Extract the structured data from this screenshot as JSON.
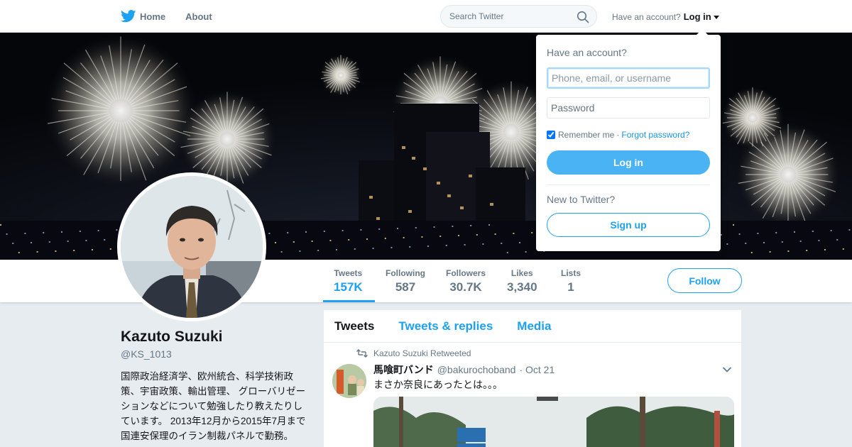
{
  "nav": {
    "home_label": "Home",
    "about_label": "About",
    "search_placeholder": "Search Twitter",
    "have_account_label": "Have an account?",
    "login_label": "Log in"
  },
  "profile": {
    "name": "Kazuto Suzuki",
    "handle": "@KS_1013",
    "bio": "国際政治経済学、欧州統合、科学技術政策、宇宙政策、輸出管理、 グローバリゼーションなどについて勉強したり教えたりしています。 2013年12月から2015年7月まで国連安保理のイラン制裁パネルで勤務。 Sorry folks, all tweets are in",
    "follow_label": "Follow"
  },
  "stats": [
    {
      "label": "Tweets",
      "value": "157K",
      "active": true
    },
    {
      "label": "Following",
      "value": "587",
      "active": false
    },
    {
      "label": "Followers",
      "value": "30.7K",
      "active": false
    },
    {
      "label": "Likes",
      "value": "3,340",
      "active": false
    },
    {
      "label": "Lists",
      "value": "1",
      "active": false
    }
  ],
  "tabs": [
    {
      "label": "Tweets",
      "active": true
    },
    {
      "label": "Tweets & replies",
      "active": false
    },
    {
      "label": "Media",
      "active": false
    }
  ],
  "tweet": {
    "retweet_context": "Kazuto Suzuki Retweeted",
    "author_name": "馬喰町バンド",
    "author_handle": "@bakurochoband",
    "date": "· Oct 21",
    "text": "まさか奈良にあったとは。。。"
  },
  "login_dropdown": {
    "title": "Have an account?",
    "username_placeholder": "Phone, email, or username",
    "password_placeholder": "Password",
    "remember_label": "Remember me",
    "separator": "·",
    "forgot_label": "Forgot password?",
    "login_button": "Log in",
    "new_label": "New to Twitter?",
    "signup_button": "Sign up"
  },
  "colors": {
    "accent": "#1da1f2",
    "login_button": "#4ab3f4",
    "background": "#e6ecf0"
  },
  "icons": [
    "twitter-bird-icon",
    "home-icon",
    "search-icon",
    "caret-down-icon",
    "retweet-icon",
    "chevron-down-icon"
  ]
}
